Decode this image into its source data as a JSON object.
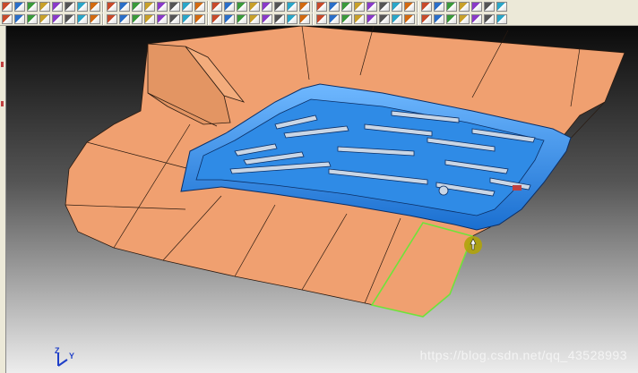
{
  "toolbar": {
    "row1": [
      "file-icon",
      "open-icon",
      "save-icon",
      "arc-icon",
      "surface-icon",
      "pipe-icon",
      "select-icon",
      "analyze-icon",
      "mirror-icon",
      "layer-icon",
      "point-icon",
      "line-icon",
      "curve-icon",
      "circle-icon",
      "arc-tool-icon",
      "spline-icon",
      "fillet-icon",
      "offset-icon",
      "trim-icon",
      "extend-icon",
      "divide-icon",
      "join-icon",
      "copy-icon",
      "measure-icon",
      "zoom-icon",
      "grid-icon",
      "color-icon",
      "light-icon",
      "level-icon",
      "render-icon",
      "shade-icon",
      "wireframe-icon",
      "pen-icon",
      "lines-icon",
      "window-icon",
      "window2-icon",
      "check-icon",
      "brush-icon",
      "cube-icon"
    ],
    "row2": [
      "view-front-icon",
      "view-top-icon",
      "view-side-icon",
      "view-iso-icon",
      "undo-icon",
      "rotate-icon",
      "pan-icon",
      "fit-icon",
      "zoom-in-icon",
      "zoom-out-icon",
      "triangle-icon",
      "line-select-icon",
      "dim-icon",
      "hide-icon",
      "show-icon",
      "cut-icon",
      "group-icon",
      "solid-icon",
      "box-icon",
      "cylinder-icon",
      "sphere-icon",
      "cone-icon",
      "move-icon",
      "scale-icon",
      "array-icon",
      "project-icon",
      "flatten-icon",
      "wrap-icon",
      "blend-icon",
      "sweep-icon",
      "loft-icon",
      "shell-icon",
      "draft-icon",
      "split-icon",
      "layer2-icon",
      "list-icon",
      "palette-icon",
      "tree-icon",
      "grid2-icon"
    ]
  },
  "viewport": {
    "background_top": "#0a0a0a",
    "background_bottom": "#ededed",
    "surface_color": "#f0a070",
    "grille_color": "#2f8be6",
    "selection_color": "#6fe33a",
    "cursor_marker_color": "#b0a30a"
  },
  "axis": {
    "z_label": "Z",
    "y_label": "Y"
  },
  "watermark": "https://blog.csdn.net/qq_43528993"
}
